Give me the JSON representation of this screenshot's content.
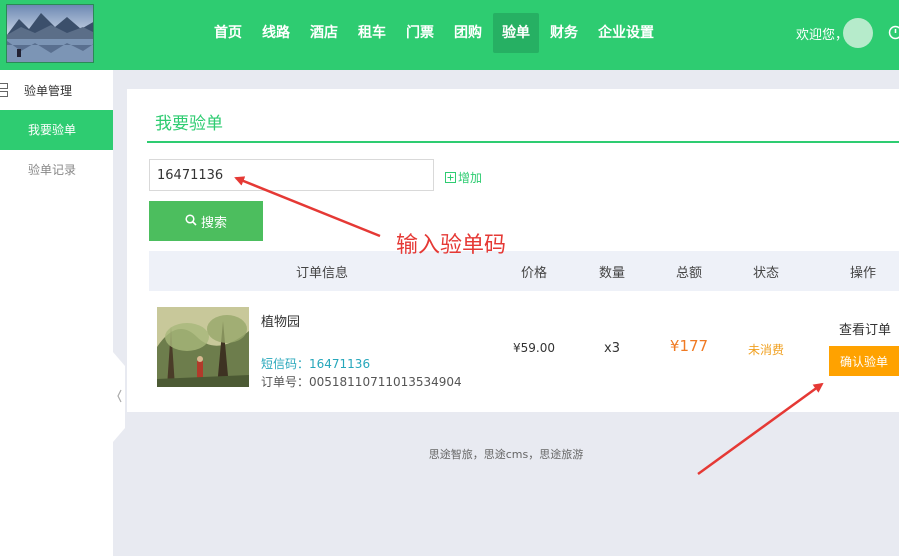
{
  "header": {
    "nav": [
      "首页",
      "线路",
      "酒店",
      "租车",
      "门票",
      "团购",
      "验单",
      "财务",
      "企业设置"
    ],
    "active_nav": "验单",
    "welcome": "欢迎您，"
  },
  "sidebar": {
    "title": "验单管理",
    "items": [
      {
        "label": "我要验单",
        "active": true
      },
      {
        "label": "验单记录",
        "active": false
      }
    ]
  },
  "main": {
    "title": "我要验单",
    "search": {
      "value": "16471136",
      "add_label": "增加",
      "button_label": "搜索"
    },
    "table": {
      "headers": [
        "订单信息",
        "价格",
        "数量",
        "总额",
        "状态",
        "操作"
      ],
      "rows": [
        {
          "product_name": "植物园",
          "sms_code": "短信码：16471136",
          "order_no": "订单号：00518110711013534904",
          "price": "¥59.00",
          "quantity": "x3",
          "total": "¥177",
          "status": "未消费",
          "view_label": "查看订单",
          "confirm_label": "确认验单"
        }
      ]
    }
  },
  "annotation": {
    "text": "输入验单码",
    "color": "#e53935"
  },
  "footer": {
    "text": "思途智旅，思途cms，思途旅游"
  },
  "colors": {
    "brand": "#2ecc71",
    "search_button": "#4cbe5e",
    "confirm_button": "#ffa200",
    "total": "#f07a23",
    "status": "#f0a020",
    "sms_code": "#26a7bb"
  }
}
